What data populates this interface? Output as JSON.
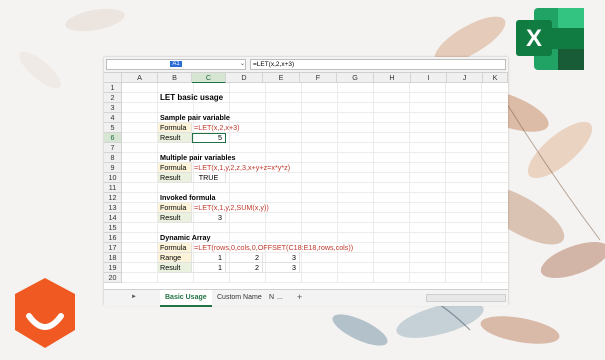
{
  "formula_bar": {
    "name_box": "A1",
    "name_box_arrow": "⌄",
    "formula": "=LET(x,2,x+3)"
  },
  "columns": [
    "A",
    "B",
    "C",
    "D",
    "E",
    "F",
    "G",
    "H",
    "I",
    "J",
    "K"
  ],
  "rows": [
    "1",
    "2",
    "3",
    "4",
    "5",
    "6",
    "7",
    "8",
    "9",
    "10",
    "11",
    "12",
    "13",
    "14",
    "15",
    "16",
    "17",
    "18",
    "19",
    "20"
  ],
  "cells": {
    "title": "LET basic usage",
    "s1_heading": "Sample pair variable",
    "s1_formula_label": "Formula",
    "s1_formula": "=LET(x,2,x+3)",
    "s1_result_label": "Result",
    "s1_result": "5",
    "s2_heading": "Multiple pair variables",
    "s2_formula_label": "Formula",
    "s2_formula": "=LET(x,1,y,2,z,3,x+y+z=x*y*z)",
    "s2_result_label": "Result",
    "s2_result": "TRUE",
    "s3_heading": "Invoked formula",
    "s3_formula_label": "Formula",
    "s3_formula": "=LET(x,1,y,2,SUM(x,y))",
    "s3_result_label": "Result",
    "s3_result": "3",
    "s4_heading": "Dynamic Array",
    "s4_formula_label": "Formula",
    "s4_formula": "=LET(rows,0,cols,0,OFFSET(C18:E18,rows,cols))",
    "s4_range_label": "Range",
    "s4_range": [
      "1",
      "2",
      "3"
    ],
    "s4_result_label": "Result",
    "s4_result": [
      "1",
      "2",
      "3"
    ]
  },
  "tabs": {
    "nav_next": "►",
    "basic_usage": "Basic Usage",
    "custom_name": "Custom Name",
    "truncated": "N",
    "more": "...",
    "add": "+"
  },
  "colors": {
    "excel_green": "#217346",
    "formula_red": "#c0392b",
    "label_fill": "#fdf3d9",
    "result_fill": "#eaf1de",
    "logo_orange": "#f05a22"
  },
  "icons": [
    "excel-logo-icon",
    "brand-badge-icon",
    "watercolor-leaves-decoration"
  ]
}
